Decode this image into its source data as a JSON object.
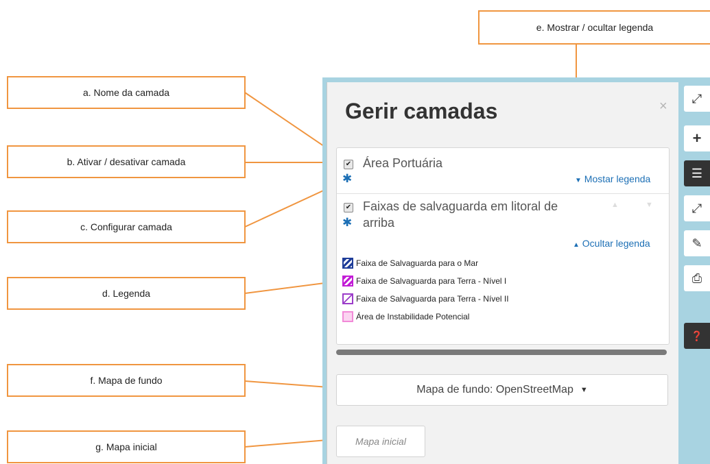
{
  "callouts": {
    "a": "a. Nome da camada",
    "b": "b. Ativar / desativar camada",
    "c": "c. Configurar camada",
    "d": "d. Legenda",
    "e": "e. Mostrar / ocultar legenda",
    "f": "f. Mapa de fundo",
    "g": "g. Mapa inicial"
  },
  "panel": {
    "title": "Gerir camadas",
    "close": "×",
    "layers": [
      {
        "name": "Área Portuária",
        "checked": true,
        "legend_toggle": "Mostar legenda"
      },
      {
        "name_line1": "Faixas de salvaguarda em litoral de",
        "name_line2": "arriba",
        "checked": true,
        "legend_toggle": "Ocultar legenda",
        "legend": [
          {
            "label": "Faixa de Salvaguarda para o Mar",
            "color": "#1f3d99"
          },
          {
            "label": "Faixa de Salvaguarda para Terra - Nível I",
            "color": "#c21cd6"
          },
          {
            "label": "Faixa de Salvaguarda para Terra - Nível II",
            "color": "#9b3cc9"
          },
          {
            "label": "Área de Instabilidade Potencial",
            "color": "#f28ad8"
          }
        ]
      }
    ],
    "basemap_label": "Mapa de fundo: OpenStreetMap",
    "initial_map_label": "Mapa inicial"
  },
  "toolbar": {
    "icons": [
      "expand-icon",
      "plus-icon",
      "layers-icon",
      "resize-icon",
      "pencil-icon",
      "print-icon",
      "help-icon"
    ],
    "active": "layers-icon"
  },
  "colors": {
    "callout_border": "#f0953f",
    "link": "#1c6fb5",
    "map": "#a8d3e1"
  }
}
